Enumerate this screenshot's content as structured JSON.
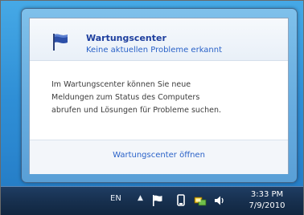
{
  "popup": {
    "title": "Wartungscenter",
    "subtitle": "Keine aktuellen Probleme erkannt",
    "message_lines": [
      "Im Wartungscenter können Sie neue",
      "Meldungen zum Status des Computers",
      "abrufen und Lösungen für Probleme suchen."
    ],
    "open_link": "Wartungscenter öffnen",
    "icon": "flag-icon"
  },
  "taskbar": {
    "language": "EN",
    "show_hidden_icons_glyph": "▲",
    "tray_icons": [
      "action-center-flag-icon",
      "removable-device-icon",
      "network-icon",
      "volume-icon"
    ],
    "clock": {
      "time": "3:33 PM",
      "date": "7/9/2010"
    }
  },
  "colors": {
    "title_blue": "#1e3f9e",
    "link_blue": "#2a62c8",
    "taskbar_dark": "#17304f",
    "desktop_blue": "#2f8fd6"
  }
}
